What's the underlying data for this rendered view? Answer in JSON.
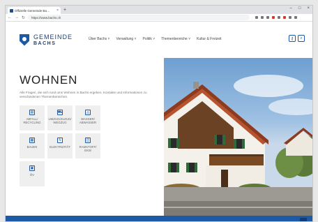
{
  "browser": {
    "tab_title": "Offizielle Gemeinde Ba…",
    "tab_close": "×",
    "new_tab": "+",
    "window_controls": [
      "–",
      "□",
      "×"
    ],
    "url": "https://www.bachs.ch",
    "nav": {
      "back": "←",
      "forward": "→",
      "reload": "↻"
    }
  },
  "site": {
    "brand_line1": "GEMEINDE",
    "brand_line2": "BACHS",
    "nav_items": [
      "Über Bachs ˅",
      "Verwaltung ˅",
      "Politik ˅",
      "Themenbereiche ˅",
      "Kultur & Freizeit"
    ],
    "header_buttons": [
      "⚷",
      "⌕"
    ]
  },
  "page": {
    "title": "WOHNEN",
    "intro": "Alle Fragen, die sich rund ums Wohnen in Bachs ergeben. Kontakte und Informationen zu verschiedenen Themenbereichen.",
    "tiles": [
      {
        "icon": "trash-icon",
        "glyph": "▤",
        "label": "ABFALL/\nRECYCLING"
      },
      {
        "icon": "truck-icon",
        "glyph": "⛟",
        "label": "UMZUG/ZUZUG/\nWEGZUG"
      },
      {
        "icon": "water-icon",
        "glyph": "◬",
        "label": "WASSER/\nABWASSER"
      },
      {
        "icon": "building-icon",
        "glyph": "▦",
        "label": "BAUEN"
      },
      {
        "icon": "lightning-icon",
        "glyph": "ϟ",
        "label": "ELEKTRIZITÄT"
      },
      {
        "icon": "leaf-icon",
        "glyph": "◫",
        "label": "RAMSTOFF/\nEKW"
      },
      {
        "icon": "bus-icon",
        "glyph": "▣",
        "label": "ÖV"
      }
    ]
  },
  "colors": {
    "brand_blue": "#1c5aa6",
    "tile_bg": "#efefef",
    "footer_band": "#1c5aa6"
  }
}
